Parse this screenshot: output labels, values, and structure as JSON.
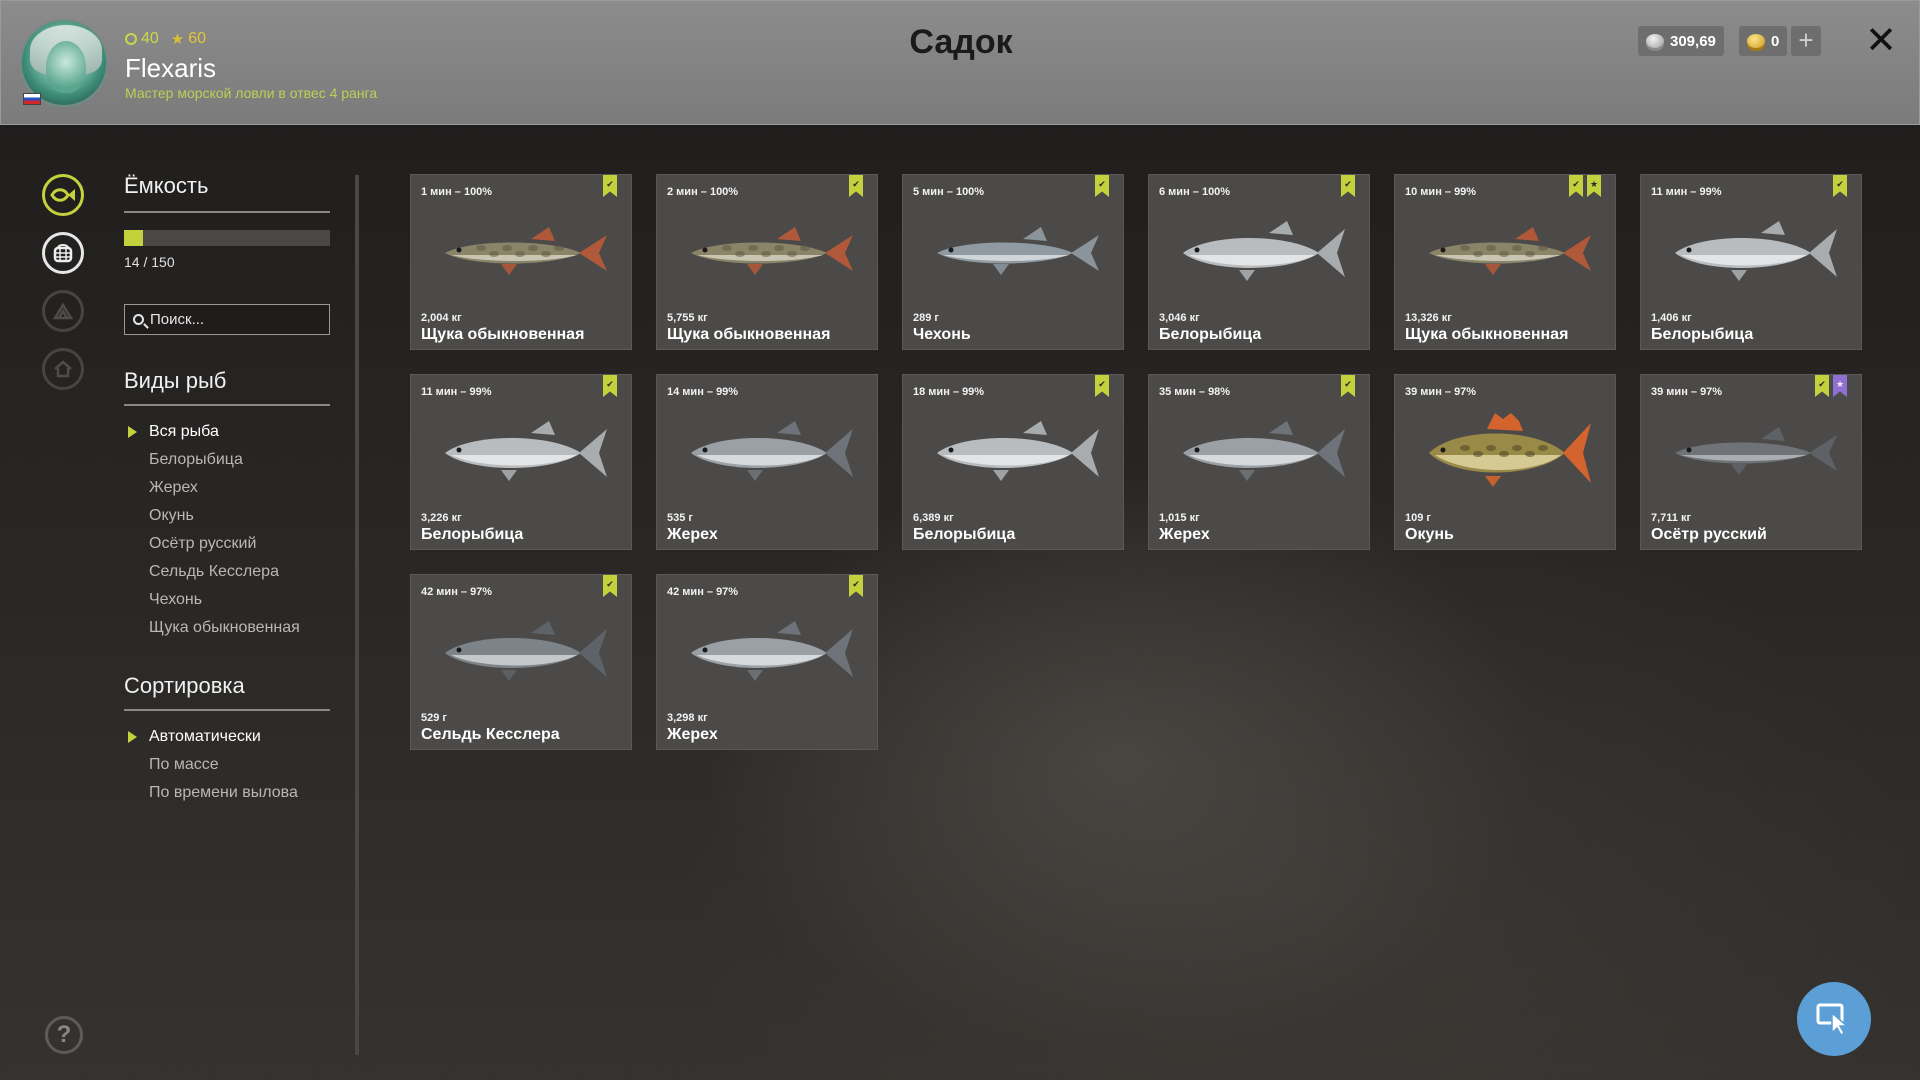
{
  "header": {
    "title": "Садок",
    "player": {
      "level": "40",
      "rank_points": "60",
      "name": "Flexaris",
      "title": "Мастер морской ловли в отвес 4 ранга"
    },
    "silver": "309,69",
    "gold": "0"
  },
  "capacity": {
    "title": "Ёмкость",
    "used": 14,
    "max": 150,
    "text": "14 / 150",
    "fill_fraction": 0.0933
  },
  "search": {
    "placeholder": "Поиск..."
  },
  "species": {
    "title": "Виды рыб",
    "items": [
      "Вся рыба",
      "Белорыбица",
      "Жерех",
      "Окунь",
      "Осётр русский",
      "Сельдь Кесслера",
      "Чехонь",
      "Щука обыкновенная"
    ],
    "selected": "Вся рыба"
  },
  "sorting": {
    "title": "Сортировка",
    "items": [
      "Автоматически",
      "По массе",
      "По времени вылова"
    ],
    "selected": "Автоматически"
  },
  "fish": [
    {
      "meta": "1 мин – 100%",
      "weight": "2,004 кг",
      "name": "Щука обыкновенная",
      "kind": "pike",
      "badges": [
        "green"
      ]
    },
    {
      "meta": "2 мин – 100%",
      "weight": "5,755 кг",
      "name": "Щука обыкновенная",
      "kind": "pike",
      "badges": [
        "green"
      ]
    },
    {
      "meta": "5 мин – 100%",
      "weight": "289 г",
      "name": "Чехонь",
      "kind": "sabre",
      "badges": [
        "green"
      ]
    },
    {
      "meta": "6 мин – 100%",
      "weight": "3,046 кг",
      "name": "Белорыбица",
      "kind": "whitefish",
      "badges": [
        "green"
      ]
    },
    {
      "meta": "10 мин – 99%",
      "weight": "13,326 кг",
      "name": "Щука обыкновенная",
      "kind": "pike",
      "badges": [
        "green",
        "green-star"
      ]
    },
    {
      "meta": "11 мин – 99%",
      "weight": "1,406 кг",
      "name": "Белорыбица",
      "kind": "whitefish",
      "badges": [
        "green"
      ]
    },
    {
      "meta": "11 мин – 99%",
      "weight": "3,226 кг",
      "name": "Белорыбица",
      "kind": "whitefish",
      "badges": [
        "green"
      ]
    },
    {
      "meta": "14 мин – 99%",
      "weight": "535 г",
      "name": "Жерех",
      "kind": "asp",
      "badges": []
    },
    {
      "meta": "18 мин – 99%",
      "weight": "6,389 кг",
      "name": "Белорыбица",
      "kind": "whitefish",
      "badges": [
        "green"
      ]
    },
    {
      "meta": "35 мин – 98%",
      "weight": "1,015 кг",
      "name": "Жерех",
      "kind": "asp",
      "badges": [
        "green"
      ]
    },
    {
      "meta": "39 мин – 97%",
      "weight": "109 г",
      "name": "Окунь",
      "kind": "perch",
      "badges": []
    },
    {
      "meta": "39 мин – 97%",
      "weight": "7,711 кг",
      "name": "Осётр русский",
      "kind": "sturgeon",
      "badges": [
        "green",
        "violet-star"
      ]
    },
    {
      "meta": "42 мин – 97%",
      "weight": "529 г",
      "name": "Сельдь Кесслера",
      "kind": "herring",
      "badges": [
        "green"
      ]
    },
    {
      "meta": "42 мин – 97%",
      "weight": "3,298 кг",
      "name": "Жерех",
      "kind": "asp",
      "badges": [
        "green"
      ]
    }
  ],
  "icons": {
    "rail": [
      "fish-tab-icon",
      "keepnet-tab-icon",
      "trophy-tab-icon",
      "home-tab-icon"
    ],
    "help": "help-icon",
    "cursor": "cursor-mode-icon"
  },
  "colors": {
    "accent": "#c3d13d",
    "header_bg": "#8c8c8c",
    "card_bg": "#4b4a48",
    "cursor_button": "#5b9fd6"
  }
}
